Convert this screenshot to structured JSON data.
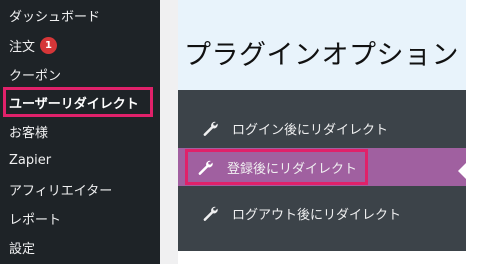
{
  "sidebar": {
    "items": [
      {
        "label": "ダッシュボード"
      },
      {
        "label": "注文",
        "badge": "1"
      },
      {
        "label": "クーポン"
      },
      {
        "label": "ユーザーリダイレクト"
      },
      {
        "label": "お客様"
      },
      {
        "label": "Zapier"
      },
      {
        "label": "アフィリエイター"
      },
      {
        "label": "レポート"
      },
      {
        "label": "設定"
      }
    ]
  },
  "header": {
    "title": "プラグインオプション"
  },
  "options": [
    {
      "label": "ログイン後にリダイレクト",
      "icon": "wrench-icon"
    },
    {
      "label": "登録後にリダイレクト",
      "icon": "wrench-icon",
      "selected": true
    },
    {
      "label": "ログアウト後にリダイレクト",
      "icon": "wrench-icon"
    }
  ],
  "colors": {
    "sidebar_bg": "#1e2327",
    "panel_bg": "#3c4349",
    "selected_bg": "#a060a0",
    "highlight": "#e0216a",
    "badge": "#d63638",
    "header_bg": "#e8f3fb"
  }
}
